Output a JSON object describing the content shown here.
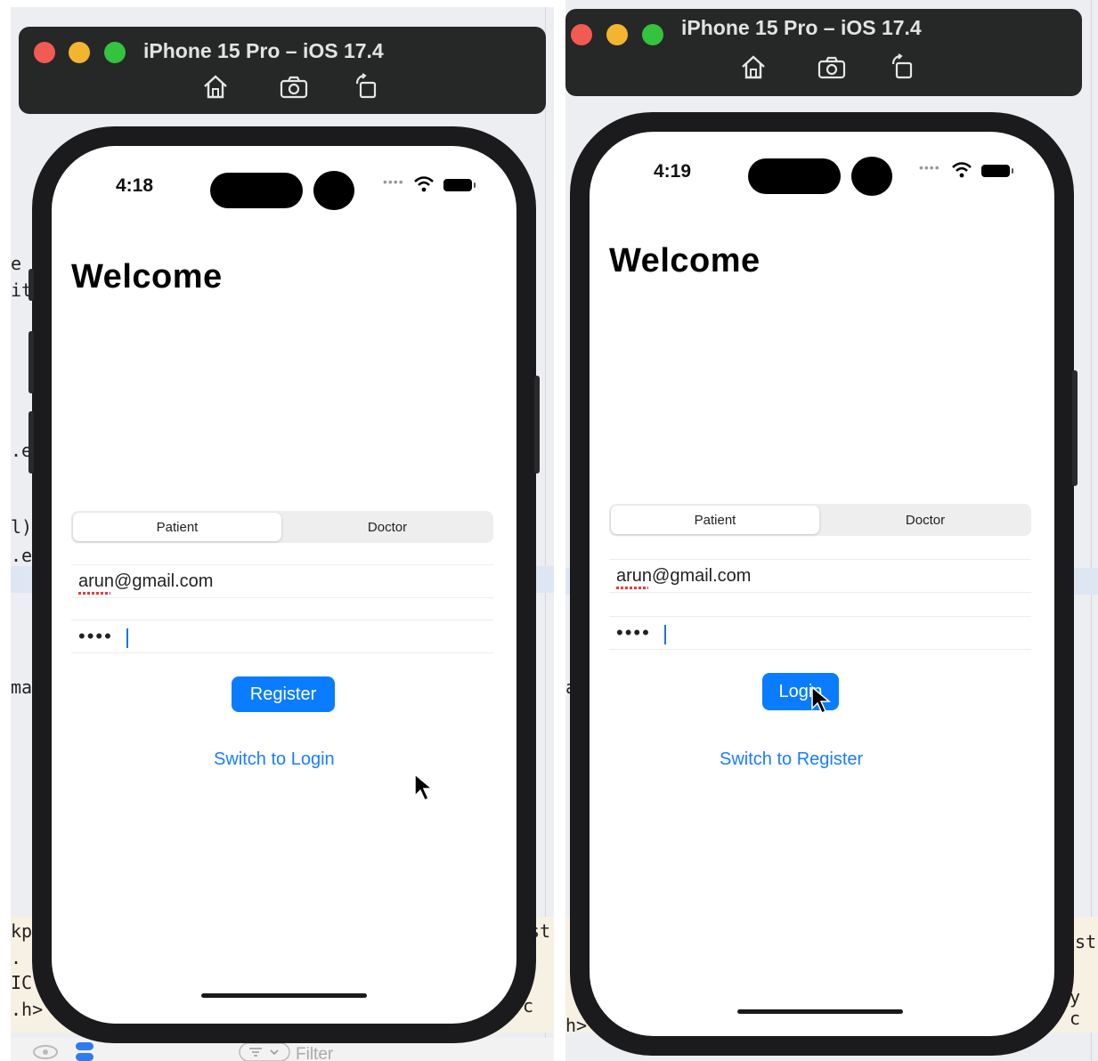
{
  "simulator_title": "iPhone 15 Pro – iOS 17.4",
  "toolbar_icons": [
    "home-icon",
    "screenshot-icon",
    "rotate-icon"
  ],
  "left_screen": {
    "time": "4:18",
    "heading": "Welcome",
    "segments": [
      "Patient",
      "Doctor"
    ],
    "selected_segment": "Patient",
    "email_value": "arun@gmail.com",
    "password_value": "••••",
    "primary_button": "Register",
    "switch_link": "Switch to Login"
  },
  "right_screen": {
    "time": "4:19",
    "heading": "Welcome",
    "segments": [
      "Patient",
      "Doctor"
    ],
    "selected_segment": "Patient",
    "email_value": "arun@gmail.com",
    "password_value": "••••",
    "primary_button": "Login",
    "switch_link": "Switch to Register"
  },
  "background": {
    "left_fragments": [
      "e",
      "it",
      ".e",
      "l)",
      ".e",
      "ma",
      "kp",
      ".",
      "IC",
      ".h>"
    ],
    "left_right_fragments": [
      "nst",
      "y c"
    ],
    "filter_label": "Filter",
    "right_fragments": [
      "a",
      "",
      "h>"
    ],
    "right_right_fragments": [
      "nst",
      "y c"
    ]
  },
  "colors": {
    "accent": "#0a7cff",
    "toolbar": "#262727",
    "traffic_red": "#f25a52",
    "traffic_yellow": "#f3b52f",
    "traffic_green": "#33c33f"
  }
}
